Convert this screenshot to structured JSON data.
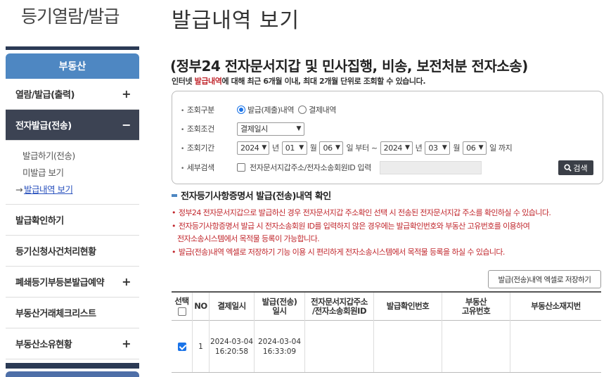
{
  "sidebar": {
    "title": "등기열람/발급",
    "header": "부동산",
    "items": [
      {
        "label": "열람/발급(출력)",
        "expander": "+"
      },
      {
        "label": "전자발급(전송)",
        "expander": "−"
      },
      {
        "label": "발급확인하기"
      },
      {
        "label": "등기신청사건처리현황"
      },
      {
        "label": "폐쇄등기부등본발급예약",
        "expander": "+"
      },
      {
        "label": "부동산거래체크리스트"
      },
      {
        "label": "부동산소유현황",
        "expander": "+"
      }
    ],
    "subitems": [
      {
        "label": "발급하기(전송)"
      },
      {
        "label": "미발급 보기"
      },
      {
        "label": "발급내역 보기",
        "marker": "→"
      }
    ]
  },
  "main": {
    "page_title": "발급내역 보기",
    "section_title": "(정부24 전자문서지갑 및 민사집행, 비송, 보전처분 전자소송)",
    "section_sub_prefix": "인터넷 ",
    "section_sub_highlight": "발급내역",
    "section_sub_suffix": "에 대해 최근 6개월 이내, 최대 2개월 단위로 조회할 수 있습니다.",
    "search": {
      "type_label": "조회구분",
      "type_option_1": "발급(제출)내역",
      "type_option_2": "결제내역",
      "cond_label": "조회조건",
      "cond_value": "결제일시",
      "period_label": "조회기간",
      "from_year": "2024",
      "from_month": "01",
      "from_day": "06",
      "to_year": "2024",
      "to_month": "03",
      "to_day": "06",
      "unit_year": "년",
      "unit_month": "월",
      "unit_from": "일 부터 ~",
      "unit_to": "일 까지",
      "detail_label": "세부검색",
      "detail_checkbox_label": "전자문서지갑주소/전자소송회원ID 입력",
      "search_button": "검색"
    },
    "info_title": "전자등기사항증명서 발급(전송)내역 확인",
    "notes": [
      "정부24 전자문서지갑으로 발급하신 경우 전자문서지갑 주소확인 선택 시 전송된 전자문서지갑 주소를 확인하실 수 있습니다.",
      "전자등기사항증명서 발급 시 전자소송회원 ID를 입력하지 않은 경우에는 발급확인번호와 부동산 고유번호를 이용하여",
      "전자소송시스템에서 목적물 등록이 가능합니다.",
      "발급(전송)내역 엑셀로 저장하기 기능 이용 시 편리하게 전자소송시스템에서 목적물 등록을 하실 수 있습니다."
    ],
    "excel_button": "발급(전송)내역 엑셀로 저장하기",
    "table": {
      "headers": {
        "select": "선택",
        "no": "NO",
        "pay_date": "결제일시",
        "issue_date_1": "발급(전송)",
        "issue_date_2": "일시",
        "wallet_1": "전자문서지갑주소",
        "wallet_2": "/전자소송회원ID",
        "confirm_no": "발급확인번호",
        "re_no_1": "부동산",
        "re_no_2": "고유번호",
        "address": "부동산소재지번"
      },
      "rows": [
        {
          "checked": true,
          "no": "1",
          "pay_date_1": "2024-03-04",
          "pay_date_2": "16:20:58",
          "issue_date_1": "2024-03-04",
          "issue_date_2": "16:33:09",
          "wallet": "",
          "confirm_no": "",
          "re_no": "",
          "address": ""
        }
      ]
    }
  }
}
